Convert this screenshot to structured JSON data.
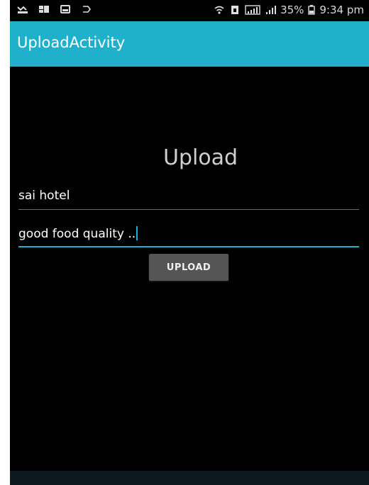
{
  "status_bar": {
    "icons_left": [
      "missed-call-icon",
      "notification-icon",
      "message-icon",
      "cast-icon"
    ],
    "icons_right": [
      "wifi-icon",
      "sim-icon",
      "signal-icon",
      "signal-icon-2"
    ],
    "battery": "35%",
    "time": "9:34 pm"
  },
  "app_bar": {
    "title": "UploadActivity",
    "color": "#1fb1cc"
  },
  "main": {
    "heading": "Upload",
    "name_field": {
      "value": "sai hotel"
    },
    "review_field": {
      "value": "good food quality .."
    },
    "upload_button": "UPLOAD"
  }
}
